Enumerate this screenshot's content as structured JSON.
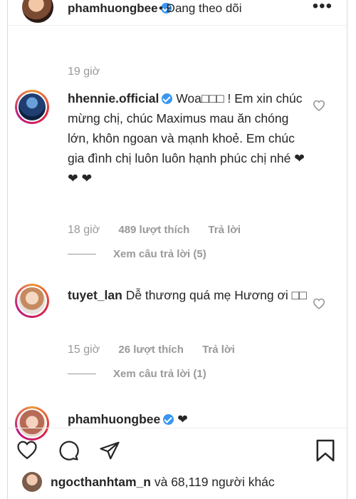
{
  "header": {
    "username": "phamhuongbee",
    "follow_status": "• Đang theo dõi",
    "more_icon": "more-dots-icon"
  },
  "first_time": "19 giờ",
  "comments": [
    {
      "username": "hhennie.official",
      "verified": true,
      "text": "Woa□□□ ! Em xin chúc mừng chị, chúc Maximus mau ăn chóng lớn, khôn ngoan và mạnh khoẻ. Em chúc gia đình chị luôn luôn hạnh phúc chị nhé ❤❤ ❤",
      "time": "18 giờ",
      "likes": "489 lượt thích",
      "reply": "Trả lời",
      "view_replies": "Xem câu trả lời (5)"
    },
    {
      "username": "tuyet_lan",
      "verified": false,
      "text": "Dễ thương quá mẹ Hương ơi □□",
      "time": "15 giờ",
      "likes": "26 lượt thích",
      "reply": "Trả lời",
      "view_replies": "Xem câu trả lời (1)"
    },
    {
      "username": "phamhuongbee",
      "verified": true,
      "text": "❤"
    }
  ],
  "actions": {
    "like_icon": "heart-outline-icon",
    "comment_icon": "comment-bubble-icon",
    "share_icon": "paper-plane-icon",
    "save_icon": "bookmark-icon"
  },
  "liked_by": {
    "user": "ngocthanhtam_n",
    "rest": "và 68,119 người khác"
  },
  "colors": {
    "text": "#262626",
    "secondary": "#999999",
    "verified": "#3897f0",
    "border": "#efefef"
  }
}
